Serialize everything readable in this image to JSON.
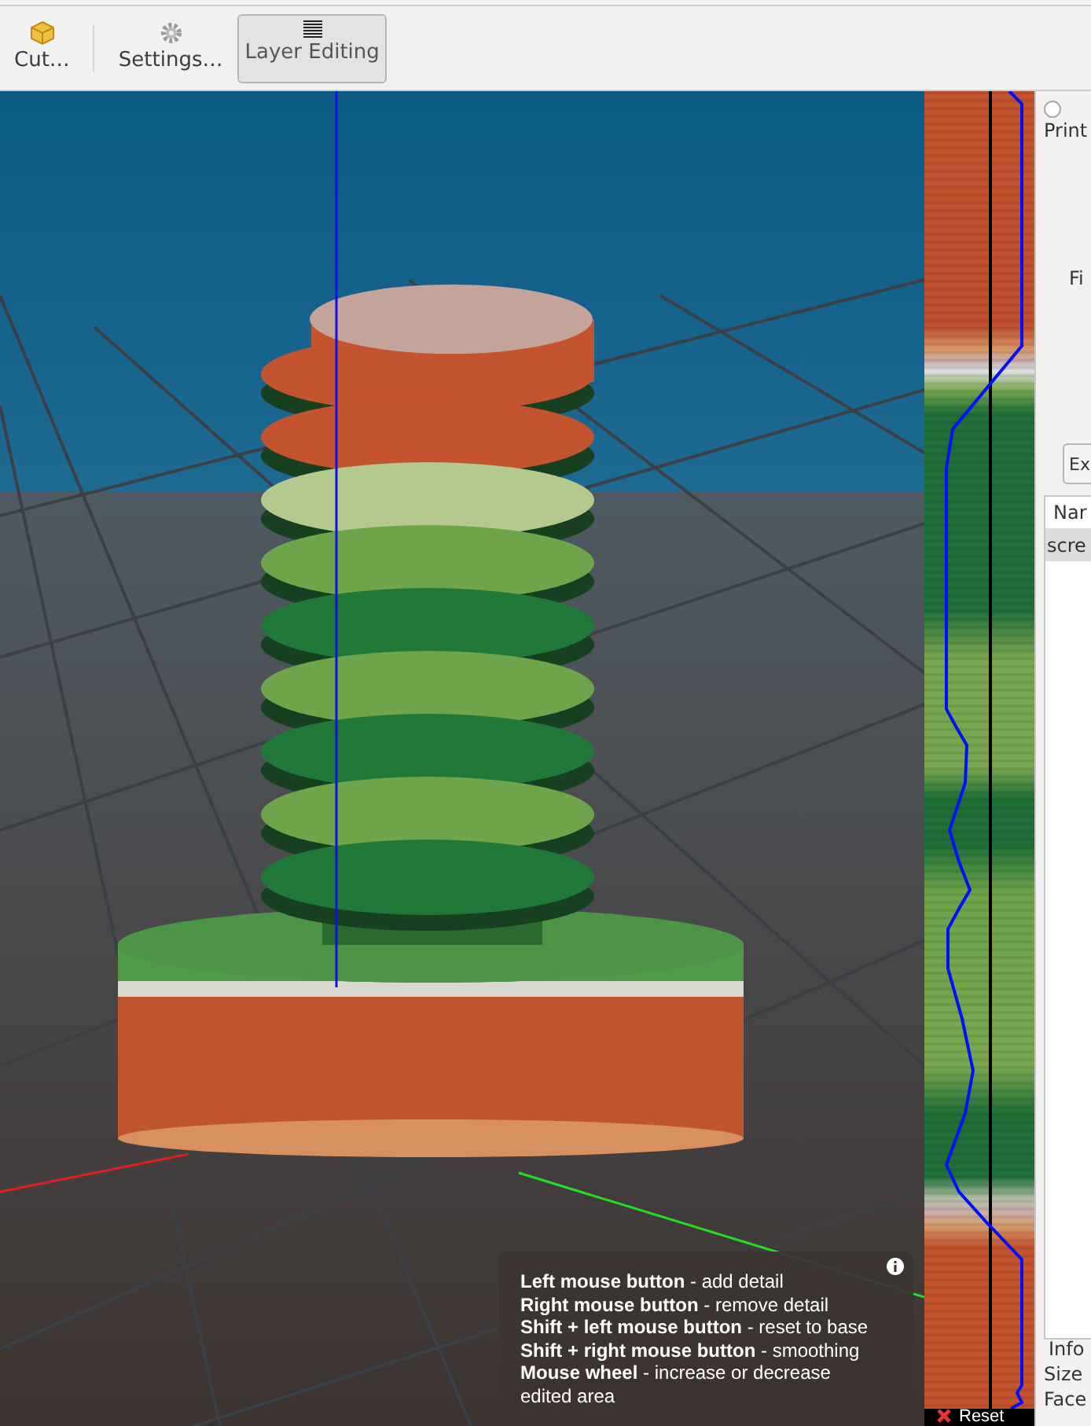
{
  "toolbar": {
    "buttons": [
      {
        "kind": "cut",
        "label": "Cut…",
        "selected": false
      },
      {
        "kind": "separator"
      },
      {
        "kind": "settings",
        "label": "Settings…",
        "selected": false
      },
      {
        "kind": "layers",
        "label": "Layer Editing",
        "selected": true
      }
    ]
  },
  "layer_editing": {
    "reset_button": "Reset",
    "tips": [
      "**Left mouse button** - add detail",
      "**Right mouse button** - remove detail",
      "**Shift + left mouse button** - reset to base",
      "**Shift + right mouse button** - smoothing",
      "**Mouse wheel** - increase or decrease edited area"
    ]
  },
  "side_panel": {
    "radio": {
      "label": "Print",
      "selected": false
    },
    "field_label": "Fi",
    "button": "Ex",
    "table": {
      "columns": [
        "Nar"
      ],
      "rows": [
        {
          "cells": [
            "scre"
          ],
          "selected": true
        }
      ]
    },
    "info": {
      "title": "Info",
      "rows": [
        "Size",
        "Face"
      ]
    }
  }
}
